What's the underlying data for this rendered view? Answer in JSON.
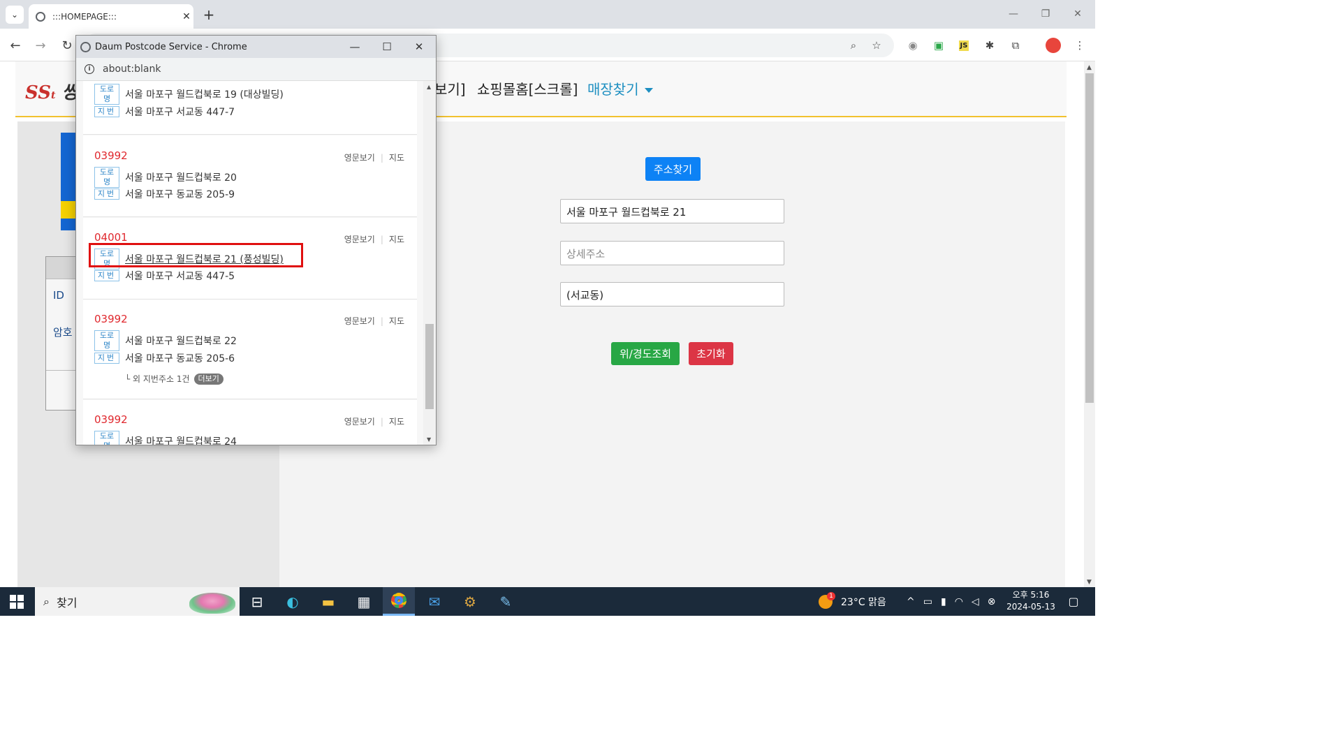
{
  "browser": {
    "tab_title": ":::HOMEPAGE:::",
    "tab_close": "✕",
    "new_tab": "+",
    "minimize": "—",
    "restore": "❐",
    "close": "✕"
  },
  "header": {
    "logo_text": "쌍용",
    "logo_initials": "SS",
    "logo_suffix": "t",
    "nav_partial": "보기]",
    "nav_shopping": "쇼핑몰홈[스크롤]",
    "nav_store": "매장찾기"
  },
  "login": {
    "id_label": "ID",
    "pw_label": "암호"
  },
  "form": {
    "find_address_button": "주소찾기",
    "road_address_value": "서울 마포구 월드컵북로 21",
    "detail_placeholder": "상세주소",
    "extra_value": "(서교동)",
    "latlng_button": "위/경도조회",
    "reset_button": "초기화"
  },
  "popup": {
    "window_title": "Daum Postcode Service - Chrome",
    "url": "about:blank",
    "tag_road": "도로명",
    "tag_jibun": "지번",
    "link_english": "영문보기",
    "link_map": "지도",
    "results": [
      {
        "zip": "",
        "road": "서울 마포구 월드컵북로 19 (대상빌딩)",
        "jibun": "서울 마포구 서교동 447-7"
      },
      {
        "zip": "03992",
        "road": "서울 마포구 월드컵북로 20",
        "jibun": "서울 마포구 동교동 205-9"
      },
      {
        "zip": "04001",
        "road": "서울 마포구 월드컵북로 21 (풍성빌딩)",
        "jibun": "서울 마포구 서교동 447-5"
      },
      {
        "zip": "03992",
        "road": "서울 마포구 월드컵북로 22",
        "jibun": "서울 마포구 동교동 205-6",
        "more_text": "└ 외 지번주소 1건",
        "more_button": "더보기"
      },
      {
        "zip": "03992",
        "road": "서울 마포구 월드컵북로 24",
        "jibun": ""
      }
    ]
  },
  "taskbar": {
    "search_text": "찾기",
    "weather": "23°C  맑음",
    "time": "오후 5:16",
    "date": "2024-05-13",
    "notification_count": "1"
  },
  "colors": {
    "accent_blue": "#0d82f5",
    "success": "#28a745",
    "danger": "#dc3545",
    "zip_red": "#e0282e",
    "highlight_red": "#e01010"
  }
}
